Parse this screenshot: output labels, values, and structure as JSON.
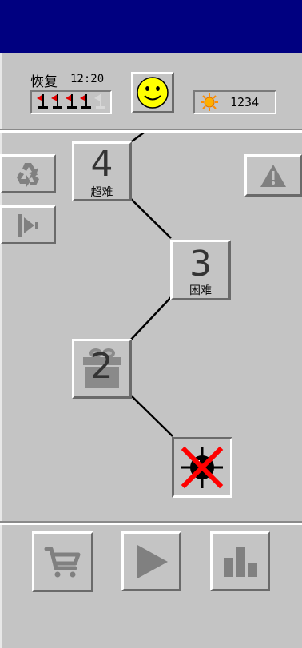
{
  "status": {
    "label": "恢复",
    "time": "12:20"
  },
  "score": {
    "value": "1234"
  },
  "levels": [
    {
      "number": "4",
      "subtitle": "超难"
    },
    {
      "number": "3",
      "subtitle": "困难"
    },
    {
      "number": "2",
      "subtitle": ""
    },
    {
      "number": "",
      "subtitle": ""
    }
  ],
  "icons": {
    "mood": "smiley-face-icon",
    "score": "sun-icon",
    "left_top": "recycle-icon",
    "left_bottom": "flag-play-icon",
    "right_top": "warning-icon",
    "level2": "gift-box-icon",
    "level1": "mine-icon",
    "bottom": [
      "cart-icon",
      "play-icon",
      "bar-chart-icon"
    ]
  },
  "flags": {
    "total": 5,
    "active": 4,
    "active_color": "#e00000"
  }
}
